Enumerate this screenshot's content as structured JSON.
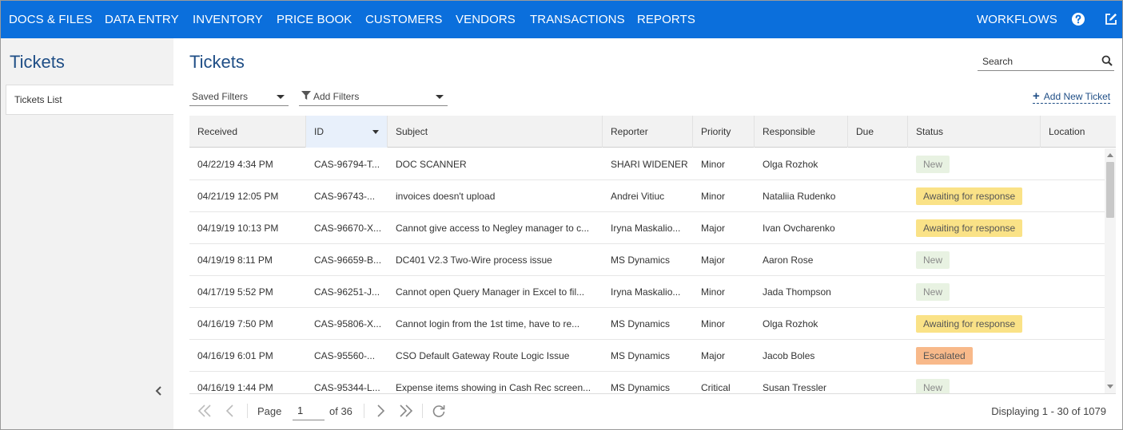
{
  "nav": {
    "items": [
      "DOCS & FILES",
      "DATA ENTRY",
      "INVENTORY",
      "PRICE BOOK",
      "CUSTOMERS",
      "VENDORS",
      "TRANSACTIONS",
      "REPORTS"
    ],
    "workflows": "WORKFLOWS",
    "icons": [
      "help-icon",
      "edit-icon"
    ]
  },
  "sidebar": {
    "title": "Tickets",
    "items": [
      {
        "label": "Tickets List"
      }
    ]
  },
  "main": {
    "title": "Tickets",
    "search_placeholder": "Search",
    "saved_filters": "Saved Filters",
    "add_filters": "Add Filters",
    "add_new_ticket": "Add New Ticket"
  },
  "table": {
    "columns": [
      "Received",
      "ID",
      "Subject",
      "Reporter",
      "Priority",
      "Responsible",
      "Due",
      "Status",
      "Location"
    ],
    "sorted_column": "ID",
    "rows": [
      {
        "received": "04/22/19 4:34 PM",
        "id": "CAS-96794-T...",
        "subject": "DOC SCANNER",
        "reporter": "SHARI WIDENER",
        "priority": "Minor",
        "responsible": "Olga Rozhok",
        "due": "",
        "status": "New",
        "location": ""
      },
      {
        "received": "04/21/19 12:05 PM",
        "id": "CAS-96743-...",
        "subject": "invoices doesn't upload",
        "reporter": "Andrei Vitiuc",
        "priority": "Minor",
        "responsible": "Nataliia Rudenko",
        "due": "",
        "status": "Awaiting for response",
        "location": ""
      },
      {
        "received": "04/19/19 10:13 PM",
        "id": "CAS-96670-X...",
        "subject": "Cannot give access to Negley manager to c...",
        "reporter": "Iryna Maskalio...",
        "priority": "Major",
        "responsible": "Ivan Ovcharenko",
        "due": "",
        "status": "Awaiting for response",
        "location": ""
      },
      {
        "received": "04/19/19 8:11 PM",
        "id": "CAS-96659-B...",
        "subject": "DC401 V2.3 Two-Wire process issue",
        "reporter": "MS Dynamics",
        "priority": "Major",
        "responsible": "Aaron Rose",
        "due": "",
        "status": "New",
        "location": ""
      },
      {
        "received": "04/17/19 5:52 PM",
        "id": "CAS-96251-J...",
        "subject": "Cannot open Query Manager in Excel to fil...",
        "reporter": "Iryna Maskalio...",
        "priority": "Minor",
        "responsible": "Jada Thompson",
        "due": "",
        "status": "New",
        "location": ""
      },
      {
        "received": "04/16/19 7:50 PM",
        "id": "CAS-95806-X...",
        "subject": "Cannot login from the 1st time, have to re...",
        "reporter": "MS Dynamics",
        "priority": "Minor",
        "responsible": "Olga Rozhok",
        "due": "",
        "status": "Awaiting for response",
        "location": ""
      },
      {
        "received": "04/16/19 6:01 PM",
        "id": "CAS-95560-...",
        "subject": "CSO Default Gateway Route Logic Issue",
        "reporter": "MS Dynamics",
        "priority": "Major",
        "responsible": "Jacob Boles",
        "due": "",
        "status": "Escalated",
        "location": ""
      },
      {
        "received": "04/16/19 1:44 PM",
        "id": "CAS-95344-L...",
        "subject": "Expense items showing in Cash Rec screen...",
        "reporter": "MS Dynamics",
        "priority": "Critical",
        "responsible": "Susan Tressler",
        "due": "",
        "status": "New",
        "location": ""
      }
    ]
  },
  "status_colors": {
    "New": "#e8f2e2",
    "Awaiting for response": "#fae287",
    "Escalated": "#f8b98a"
  },
  "pager": {
    "page_label": "Page",
    "current_page": "1",
    "of_label": "of 36",
    "status": "Displaying 1 - 30 of 1079"
  },
  "colors": {
    "nav_bg": "#0b6fdc",
    "title": "#1f4e86"
  }
}
